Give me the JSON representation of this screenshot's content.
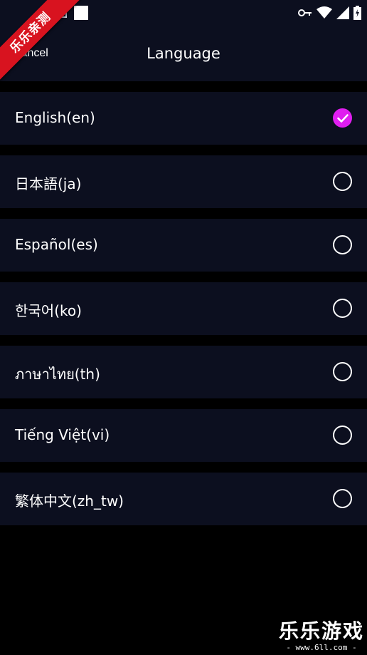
{
  "header": {
    "cancel_label": "Cancel",
    "title": "Language"
  },
  "languages": [
    {
      "label": "English(en)",
      "selected": true
    },
    {
      "label": "日本語(ja)",
      "selected": false
    },
    {
      "label": "Español(es)",
      "selected": false
    },
    {
      "label": "한국어(ko)",
      "selected": false
    },
    {
      "label": "ภาษาไทย(th)",
      "selected": false
    },
    {
      "label": "Tiếng Việt(vi)",
      "selected": false
    },
    {
      "label": "繁体中文(zh_tw)",
      "selected": false
    }
  ],
  "overlay": {
    "ribbon_text": "乐乐亲测",
    "watermark_title": "乐乐游戏",
    "watermark_url": "- www.6ll.com -"
  },
  "colors": {
    "background": "#000000",
    "surface": "#0c0f1f",
    "accent": "#e01ef0",
    "ribbon": "#d8131f"
  },
  "icons": {
    "status_left": [
      "square-icon",
      "image-icon"
    ],
    "status_right": [
      "key-icon",
      "wifi-icon",
      "signal-icon",
      "battery-charging-icon"
    ],
    "selected": "check-circle-icon",
    "unselected": "radio-empty-icon"
  }
}
